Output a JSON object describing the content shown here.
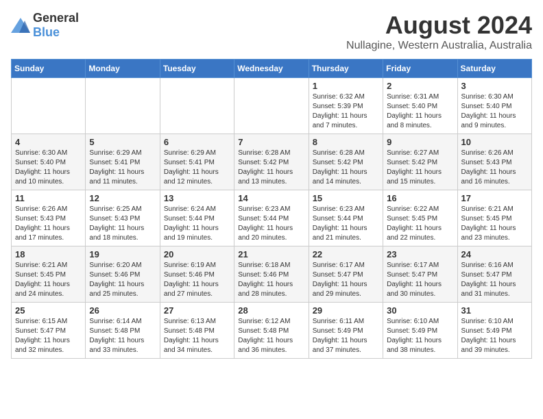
{
  "logo": {
    "general": "General",
    "blue": "Blue"
  },
  "title": "August 2024",
  "subtitle": "Nullagine, Western Australia, Australia",
  "headers": [
    "Sunday",
    "Monday",
    "Tuesday",
    "Wednesday",
    "Thursday",
    "Friday",
    "Saturday"
  ],
  "weeks": [
    [
      {
        "day": "",
        "info": ""
      },
      {
        "day": "",
        "info": ""
      },
      {
        "day": "",
        "info": ""
      },
      {
        "day": "",
        "info": ""
      },
      {
        "day": "1",
        "info": "Sunrise: 6:32 AM\nSunset: 5:39 PM\nDaylight: 11 hours and 7 minutes."
      },
      {
        "day": "2",
        "info": "Sunrise: 6:31 AM\nSunset: 5:40 PM\nDaylight: 11 hours and 8 minutes."
      },
      {
        "day": "3",
        "info": "Sunrise: 6:30 AM\nSunset: 5:40 PM\nDaylight: 11 hours and 9 minutes."
      }
    ],
    [
      {
        "day": "4",
        "info": "Sunrise: 6:30 AM\nSunset: 5:40 PM\nDaylight: 11 hours and 10 minutes."
      },
      {
        "day": "5",
        "info": "Sunrise: 6:29 AM\nSunset: 5:41 PM\nDaylight: 11 hours and 11 minutes."
      },
      {
        "day": "6",
        "info": "Sunrise: 6:29 AM\nSunset: 5:41 PM\nDaylight: 11 hours and 12 minutes."
      },
      {
        "day": "7",
        "info": "Sunrise: 6:28 AM\nSunset: 5:42 PM\nDaylight: 11 hours and 13 minutes."
      },
      {
        "day": "8",
        "info": "Sunrise: 6:28 AM\nSunset: 5:42 PM\nDaylight: 11 hours and 14 minutes."
      },
      {
        "day": "9",
        "info": "Sunrise: 6:27 AM\nSunset: 5:42 PM\nDaylight: 11 hours and 15 minutes."
      },
      {
        "day": "10",
        "info": "Sunrise: 6:26 AM\nSunset: 5:43 PM\nDaylight: 11 hours and 16 minutes."
      }
    ],
    [
      {
        "day": "11",
        "info": "Sunrise: 6:26 AM\nSunset: 5:43 PM\nDaylight: 11 hours and 17 minutes."
      },
      {
        "day": "12",
        "info": "Sunrise: 6:25 AM\nSunset: 5:43 PM\nDaylight: 11 hours and 18 minutes."
      },
      {
        "day": "13",
        "info": "Sunrise: 6:24 AM\nSunset: 5:44 PM\nDaylight: 11 hours and 19 minutes."
      },
      {
        "day": "14",
        "info": "Sunrise: 6:23 AM\nSunset: 5:44 PM\nDaylight: 11 hours and 20 minutes."
      },
      {
        "day": "15",
        "info": "Sunrise: 6:23 AM\nSunset: 5:44 PM\nDaylight: 11 hours and 21 minutes."
      },
      {
        "day": "16",
        "info": "Sunrise: 6:22 AM\nSunset: 5:45 PM\nDaylight: 11 hours and 22 minutes."
      },
      {
        "day": "17",
        "info": "Sunrise: 6:21 AM\nSunset: 5:45 PM\nDaylight: 11 hours and 23 minutes."
      }
    ],
    [
      {
        "day": "18",
        "info": "Sunrise: 6:21 AM\nSunset: 5:45 PM\nDaylight: 11 hours and 24 minutes."
      },
      {
        "day": "19",
        "info": "Sunrise: 6:20 AM\nSunset: 5:46 PM\nDaylight: 11 hours and 25 minutes."
      },
      {
        "day": "20",
        "info": "Sunrise: 6:19 AM\nSunset: 5:46 PM\nDaylight: 11 hours and 27 minutes."
      },
      {
        "day": "21",
        "info": "Sunrise: 6:18 AM\nSunset: 5:46 PM\nDaylight: 11 hours and 28 minutes."
      },
      {
        "day": "22",
        "info": "Sunrise: 6:17 AM\nSunset: 5:47 PM\nDaylight: 11 hours and 29 minutes."
      },
      {
        "day": "23",
        "info": "Sunrise: 6:17 AM\nSunset: 5:47 PM\nDaylight: 11 hours and 30 minutes."
      },
      {
        "day": "24",
        "info": "Sunrise: 6:16 AM\nSunset: 5:47 PM\nDaylight: 11 hours and 31 minutes."
      }
    ],
    [
      {
        "day": "25",
        "info": "Sunrise: 6:15 AM\nSunset: 5:47 PM\nDaylight: 11 hours and 32 minutes."
      },
      {
        "day": "26",
        "info": "Sunrise: 6:14 AM\nSunset: 5:48 PM\nDaylight: 11 hours and 33 minutes."
      },
      {
        "day": "27",
        "info": "Sunrise: 6:13 AM\nSunset: 5:48 PM\nDaylight: 11 hours and 34 minutes."
      },
      {
        "day": "28",
        "info": "Sunrise: 6:12 AM\nSunset: 5:48 PM\nDaylight: 11 hours and 36 minutes."
      },
      {
        "day": "29",
        "info": "Sunrise: 6:11 AM\nSunset: 5:49 PM\nDaylight: 11 hours and 37 minutes."
      },
      {
        "day": "30",
        "info": "Sunrise: 6:10 AM\nSunset: 5:49 PM\nDaylight: 11 hours and 38 minutes."
      },
      {
        "day": "31",
        "info": "Sunrise: 6:10 AM\nSunset: 5:49 PM\nDaylight: 11 hours and 39 minutes."
      }
    ]
  ]
}
